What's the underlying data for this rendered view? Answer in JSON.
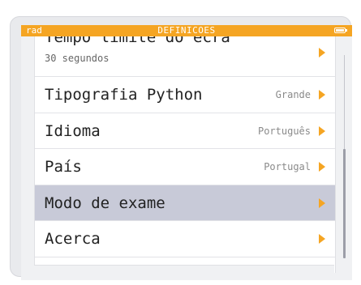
{
  "statusbar": {
    "angle_mode": "rad",
    "title": "DEFINICOES",
    "battery_icon": "battery-full-icon"
  },
  "menu": {
    "items": [
      {
        "label": "Tempo limite do ecrã",
        "sublabel": "30 segundos",
        "value": "",
        "highlighted": false
      },
      {
        "label": "Tipografia Python",
        "sublabel": "",
        "value": "Grande",
        "highlighted": false
      },
      {
        "label": "Idioma",
        "sublabel": "",
        "value": "Português",
        "highlighted": false
      },
      {
        "label": "País",
        "sublabel": "",
        "value": "Portugal",
        "highlighted": false
      },
      {
        "label": "Modo de exame",
        "sublabel": "",
        "value": "",
        "highlighted": true
      },
      {
        "label": "Acerca",
        "sublabel": "",
        "value": "",
        "highlighted": false
      }
    ]
  },
  "colors": {
    "accent": "#f5a523",
    "highlight_row": "#c8cad8",
    "background": "#f0f1f3"
  }
}
